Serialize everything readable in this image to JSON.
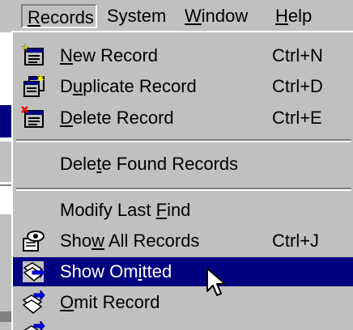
{
  "menubar": {
    "records": {
      "pre": "",
      "ul": "R",
      "post": "ecords"
    },
    "system": "System",
    "window": {
      "pre": "",
      "ul": "W",
      "post": "indow"
    },
    "help": {
      "pre": "",
      "ul": "H",
      "post": "elp"
    }
  },
  "menu": {
    "new_record": {
      "pre": "",
      "ul": "N",
      "post": "ew Record",
      "shortcut": "Ctrl+N",
      "icon": "new-record-icon"
    },
    "duplicate_record": {
      "pre": "D",
      "ul": "u",
      "post": "plicate Record",
      "shortcut": "Ctrl+D",
      "icon": "duplicate-record-icon"
    },
    "delete_record": {
      "pre": "",
      "ul": "D",
      "post": "elete Record",
      "shortcut": "Ctrl+E",
      "icon": "delete-record-icon"
    },
    "delete_found": {
      "pre": "Dele",
      "ul": "t",
      "post": "e Found Records"
    },
    "modify_last_find": {
      "pre": "Modify Last ",
      "ul": "F",
      "post": "ind"
    },
    "show_all": {
      "pre": "Sho",
      "ul": "w",
      "post": " All Records",
      "shortcut": "Ctrl+J",
      "icon": "show-all-records-icon"
    },
    "show_omitted": {
      "pre": "Show Om",
      "ul": "i",
      "post": "tted",
      "icon": "show-omitted-icon"
    },
    "omit_record": {
      "pre": "",
      "ul": "O",
      "post": "mit Record",
      "icon": "omit-record-icon"
    }
  },
  "colors": {
    "highlight": "#000080",
    "menu_bg": "#c0c0c0"
  }
}
